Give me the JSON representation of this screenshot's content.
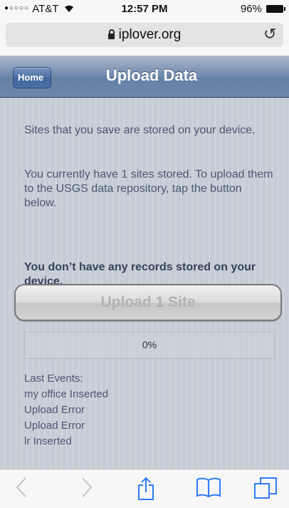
{
  "status_bar": {
    "signal_dots": "●○○○○",
    "carrier": "AT&T",
    "wifi_icon": "wifi-icon",
    "time": "12:57 PM",
    "battery_percent": "96%",
    "battery_level": 96
  },
  "address_bar": {
    "url": "iplover.org",
    "lock_icon": "lock-icon",
    "reload_icon": "reload-icon"
  },
  "nav": {
    "back_label": "Home",
    "title": "Upload Data"
  },
  "content": {
    "paragraph_1": "Sites that you save are stored on your device.",
    "paragraph_2": "You currently have 1 sites stored. To upload them to the USGS data repository, tap the button below.",
    "notice": "You don’t have any records stored on your device.",
    "upload_button": "Upload 1 Site",
    "upload_progress_percent": 0,
    "progress_label": "0%",
    "events_title": "Last Events:",
    "events": [
      "my office Inserted",
      "Upload Error",
      "Upload Error",
      "lr Inserted"
    ]
  },
  "toolbar": {
    "back_icon": "back-arrow-icon",
    "forward_icon": "forward-arrow-icon",
    "share_icon": "share-icon",
    "bookmarks_icon": "bookmarks-icon",
    "tabs_icon": "tabs-icon"
  },
  "colors": {
    "nav_bar": "#6d87ab",
    "ios_blue": "#2f7cf6",
    "text": "#4b5874"
  }
}
